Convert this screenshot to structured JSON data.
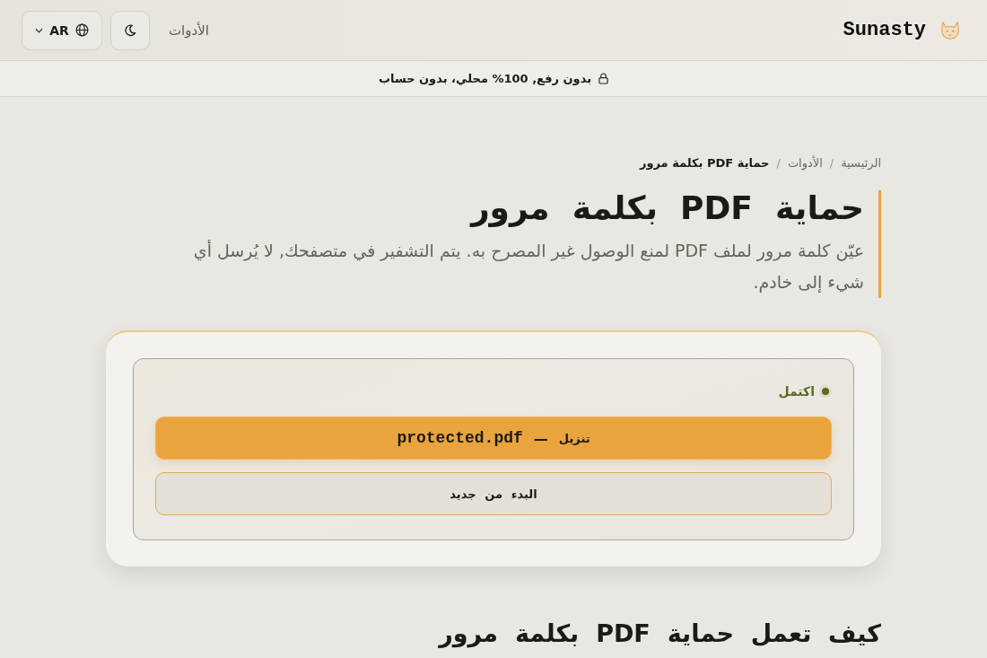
{
  "header": {
    "logo_text": "Sunasty",
    "nav_link": "الأدوات",
    "language_button": "AR"
  },
  "banner": {
    "text": "بدون رفع, 100% محلي، بدون حساب"
  },
  "breadcrumb": [
    {
      "label": "الرئيسية",
      "current": false,
      "separator": "/"
    },
    {
      "label": "الأدوات",
      "current": false,
      "separator": "/"
    },
    {
      "label": "حماية PDF بكلمة مرور",
      "current": true
    }
  ],
  "page": {
    "title": "حماية PDF بكلمة مرور",
    "subtitle": "عيّن كلمة مرور لملف PDF لمنع الوصول غير المصرح به. يتم التشفير في متصفحك, لا يُرسل أي شيء إلى خادم."
  },
  "result_card": {
    "status": "اكتمل",
    "download_button": {
      "label": "تنزيل",
      "separator": "—",
      "filename": "protected.pdf"
    },
    "restart_button": "البدء من جديد"
  },
  "section_heading": "كيف تعمل حماية PDF بكلمة مرور"
}
